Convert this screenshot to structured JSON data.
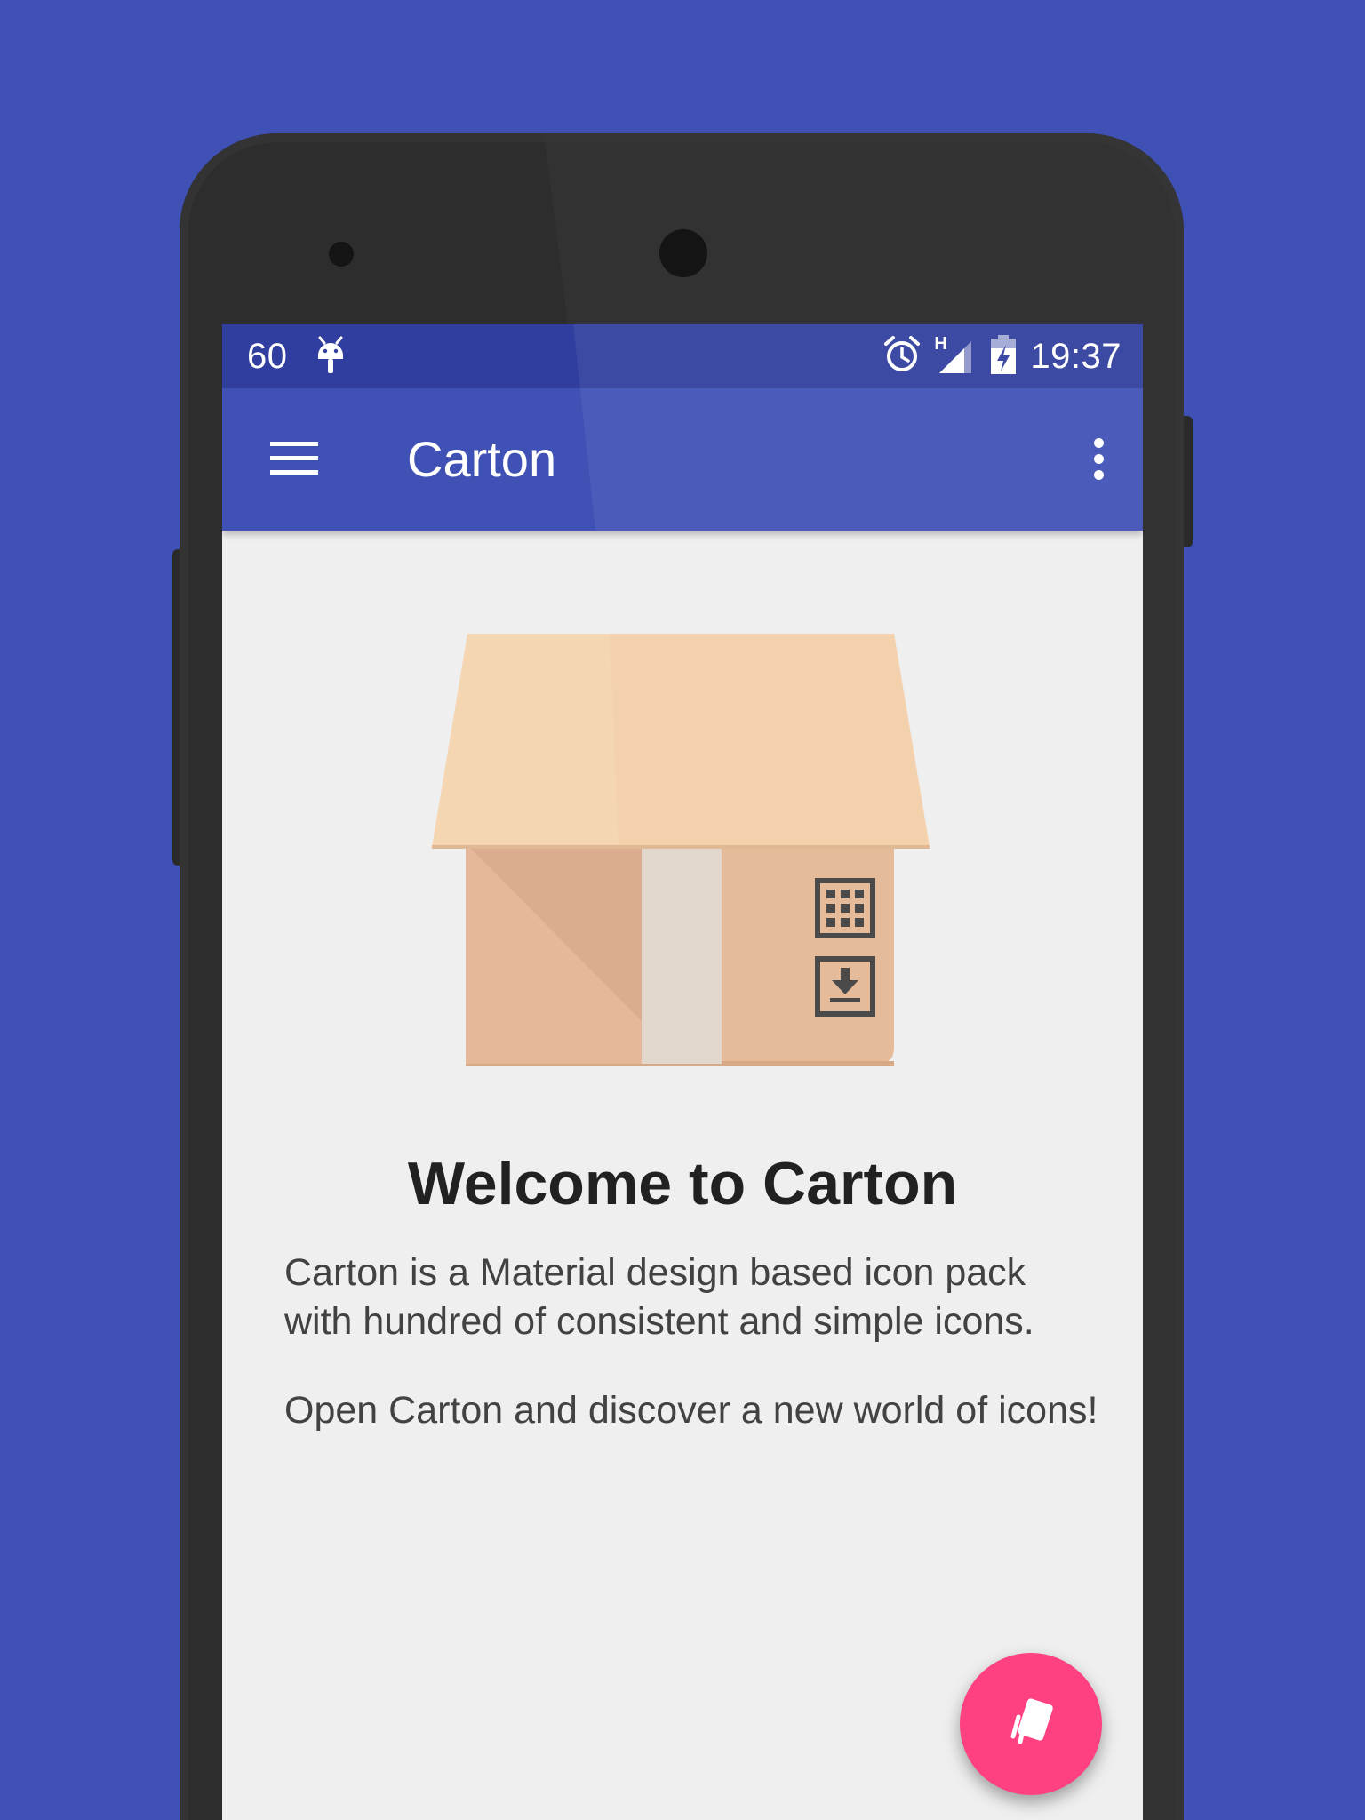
{
  "status_bar": {
    "left_value": "60",
    "left_icon": "android-debug-icon",
    "icons": [
      "alarm-icon",
      "signal-h-icon",
      "battery-charging-icon"
    ],
    "network_label": "H",
    "time": "19:37"
  },
  "app_bar": {
    "menu_icon": "hamburger-menu-icon",
    "title": "Carton",
    "overflow_icon": "more-vert-icon"
  },
  "content": {
    "hero_icon": "carton-box-icon",
    "title": "Welcome to Carton",
    "paragraphs": [
      "Carton is a Material design based icon pack with hundred of consistent and simple icons.",
      "Open Carton and discover a new world of icons!"
    ]
  },
  "fab": {
    "icon": "card-swatch-icon"
  },
  "colors": {
    "background": "#3f51b5",
    "status_bar": "#303f9f",
    "app_bar": "#3f51b5",
    "content_bg": "#efefef",
    "fab": "#ff4081"
  }
}
